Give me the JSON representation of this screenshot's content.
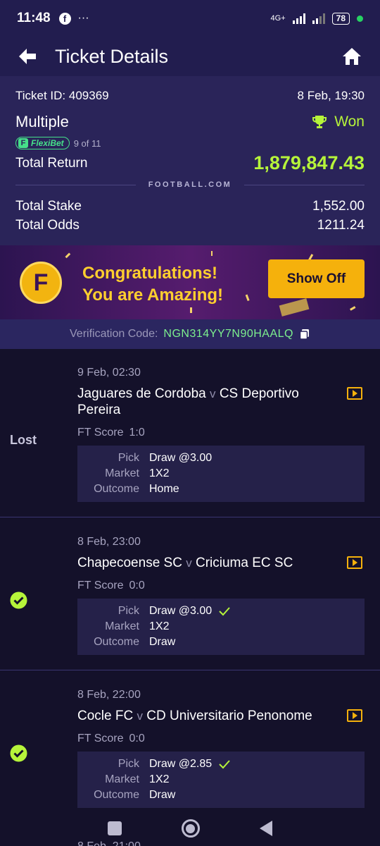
{
  "status_bar": {
    "time": "11:48",
    "app_icon": "facebook-icon",
    "more": "···",
    "network": "4G+",
    "battery": "78"
  },
  "header": {
    "title": "Ticket Details"
  },
  "ticket": {
    "id_label": "Ticket ID: 409369",
    "datetime": "8 Feb, 19:30",
    "bet_type": "Multiple",
    "result": "Won",
    "flexibet_label": "FlexiBet",
    "flexibet_count": "9 of 11",
    "total_return_label": "Total Return",
    "total_return": "1,879,847.43",
    "brand": "FOOTBALL.COM",
    "total_stake_label": "Total Stake",
    "total_stake": "1,552.00",
    "total_odds_label": "Total Odds",
    "total_odds": "1211.24"
  },
  "banner": {
    "line1": "Congratulations!",
    "line2": "You are Amazing!",
    "button": "Show Off",
    "logo_letter": "F"
  },
  "verification": {
    "label": "Verification Code:",
    "code": "NGN314YY7N90HAALQ"
  },
  "matches": [
    {
      "status": "Lost",
      "date": "9 Feb, 02:30",
      "home": "Jaguares de Cordoba",
      "v": "v",
      "away": "CS Deportivo Pereira",
      "score_label": "FT Score",
      "score": "1:0",
      "pick_label": "Pick",
      "pick": "Draw @3.00",
      "market_label": "Market",
      "market": "1X2",
      "outcome_label": "Outcome",
      "outcome": "Home"
    },
    {
      "status": "won",
      "date": "8 Feb, 23:00",
      "home": "Chapecoense SC",
      "v": "v",
      "away": "Criciuma EC SC",
      "score_label": "FT Score",
      "score": "0:0",
      "pick_label": "Pick",
      "pick": "Draw @3.00",
      "market_label": "Market",
      "market": "1X2",
      "outcome_label": "Outcome",
      "outcome": "Draw"
    },
    {
      "status": "won",
      "date": "8 Feb, 22:00",
      "home": "Cocle FC",
      "v": "v",
      "away": "CD Universitario Penonome",
      "score_label": "FT Score",
      "score": "0:0",
      "pick_label": "Pick",
      "pick": "Draw @2.85",
      "market_label": "Market",
      "market": "1X2",
      "outcome_label": "Outcome",
      "outcome": "Draw"
    }
  ],
  "next_match_peek": "8 Feb, 21:00",
  "colors": {
    "accent_green": "#b6f43a",
    "header_bg": "#221d4f",
    "summary_bg": "#2a2459",
    "list_bg": "#14112a",
    "button_yellow": "#f5b10c"
  }
}
